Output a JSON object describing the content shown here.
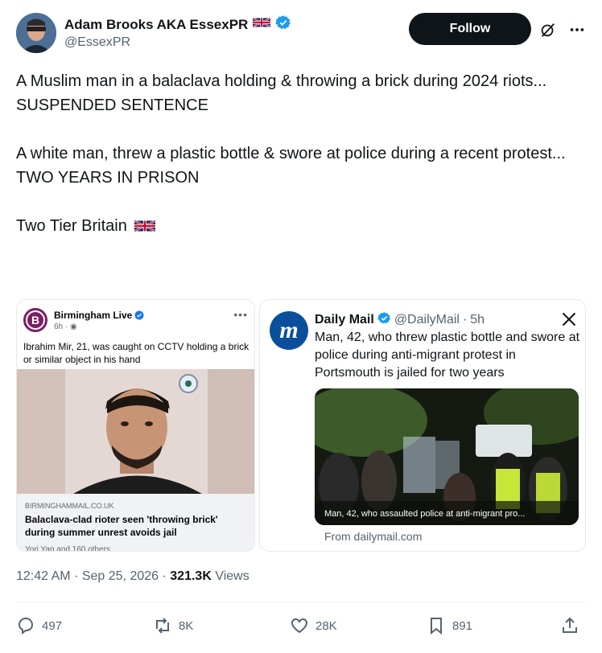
{
  "author": {
    "display_name": "Adam Brooks AKA EssexPR",
    "handle": "@EssexPR",
    "follow_label": "Follow"
  },
  "tweet": {
    "paragraphs": [
      [
        "A Muslim man in a balaclava holding & throwing a brick during 2024 riots...",
        "SUSPENDED SENTENCE"
      ],
      [
        "A white man, threw a plastic bottle & swore at police during a recent protest...",
        "TWO YEARS IN PRISON"
      ],
      [
        "Two Tier Britain"
      ]
    ]
  },
  "card_left": {
    "page_name": "Birmingham Live",
    "time": "6h",
    "post_text": "Ibrahim Mir, 21, was caught on CCTV holding a brick or similar object in his hand",
    "domain": "BIRMINGHAMMAIL.CO.UK",
    "headline": "Balaclava-clad rioter seen 'throwing brick' during summer unrest avoids jail",
    "reactions": "Yori Yap and 160 others"
  },
  "card_right": {
    "name": "Daily Mail",
    "handle": "@DailyMail",
    "time": "5h",
    "text": "Man, 42, who threw plastic bottle and swore at police during anti-migrant protest in Portsmouth is jailed for two years",
    "photo_caption": "Man, 42, who assaulted police at anti-migrant pro...",
    "from": "From dailymail.com"
  },
  "meta": {
    "time": "12:42 AM",
    "date": "Sep 25, 2026",
    "views_count": "321.3K",
    "views_label": "Views"
  },
  "actions": {
    "replies": "497",
    "reposts": "8K",
    "likes": "28K",
    "bookmarks": "891"
  },
  "colors": {
    "verified": "#1d9bf0",
    "text_secondary": "#536471",
    "follow_bg": "#0f1419",
    "daily_mail_blue": "#0b4f9c",
    "birmingham_live_purple": "#7a1f63"
  }
}
